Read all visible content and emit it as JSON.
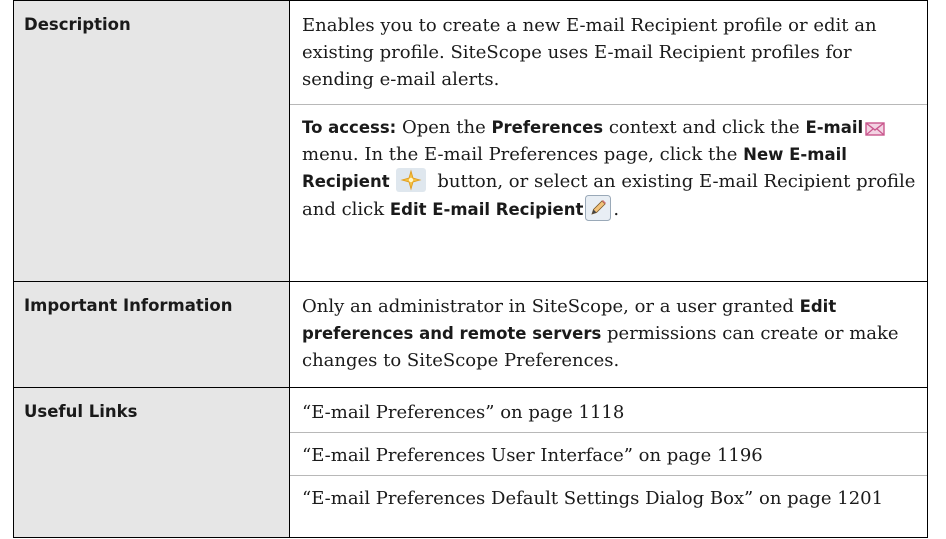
{
  "rows": {
    "description": {
      "label": "Description",
      "para1": "Enables you to create a new E-mail Recipient profile or edit an existing profile. SiteScope uses E-mail Recipient profiles for sending e-mail alerts.",
      "access_label": "To access:",
      "access_t1": " Open the ",
      "access_b1": "Preferences",
      "access_t2": " context and click the ",
      "access_b2": "E-mail",
      "access_t3": " menu. In the E-mail Preferences page, click the ",
      "access_b3": "New E-mail Recipient",
      "access_t4": " button, or select an existing E-mail Recipient profile and click ",
      "access_b4": "Edit E-mail Recipient",
      "access_t5": "."
    },
    "important": {
      "label": "Important Information",
      "t1": "Only an administrator in SiteScope, or a user granted ",
      "b1": "Edit preferences and remote servers",
      "t2": " permissions can create or make changes to SiteScope Preferences."
    },
    "links": {
      "label": "Useful Links",
      "items": [
        "“E-mail Preferences” on page 1118",
        "“E-mail Preferences User Interface” on page 1196",
        "“E-mail Preferences Default Settings Dialog Box” on page 1201"
      ]
    }
  },
  "icons": {
    "email": "envelope-icon",
    "new": "new-star-icon",
    "edit": "pencil-icon"
  },
  "colors": {
    "label_bg": "#e6e6e6",
    "envelope": "#e9a9c9",
    "star": "#f4c040"
  }
}
